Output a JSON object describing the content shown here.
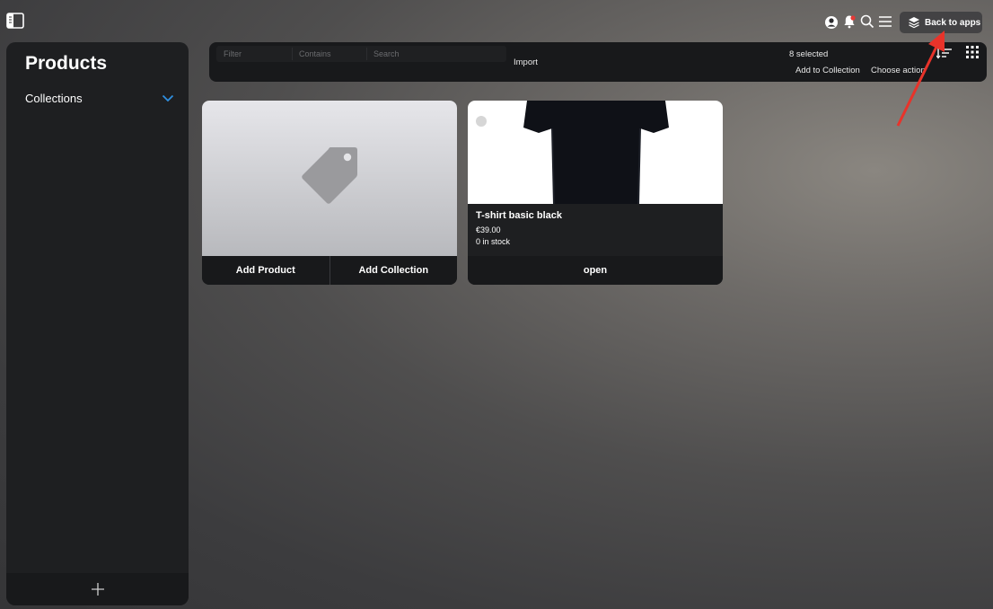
{
  "topbar": {
    "back_to_apps_label": "Back to apps",
    "icons": [
      "sidebar-toggle-icon",
      "user-icon",
      "bell-icon",
      "search-icon",
      "menu-icon",
      "layers-icon"
    ],
    "notification_color": "#e53935"
  },
  "sidebar": {
    "title": "Products",
    "collections_label": "Collections",
    "accent": "#2f8fe0"
  },
  "toolbar": {
    "filter_placeholder": "Filter",
    "contains_placeholder": "Contains",
    "search_placeholder": "Search",
    "import_label": "Import",
    "selected_count": "8 selected",
    "add_to_collection_label": "Add to Collection",
    "choose_action_label": "Choose action"
  },
  "cards": {
    "placeholder": {
      "add_product_label": "Add Product",
      "add_collection_label": "Add Collection"
    },
    "product": {
      "name": "T-shirt basic black",
      "price": "€39.00",
      "stock": "0 in stock",
      "open_label": "open"
    }
  },
  "annotation": {
    "arrow_color": "#e8332a"
  }
}
